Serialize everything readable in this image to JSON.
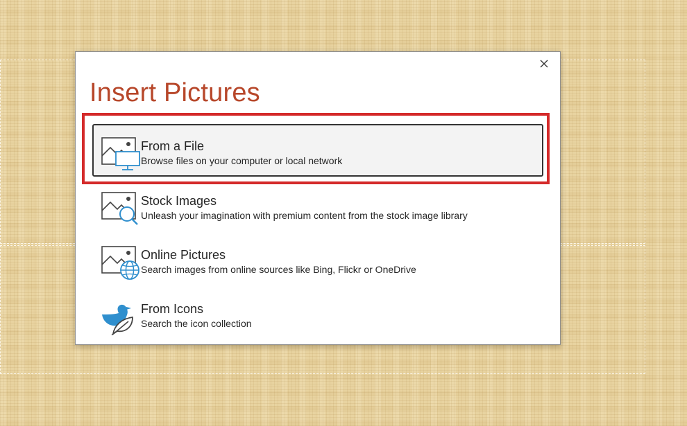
{
  "dialog": {
    "title": "Insert Pictures",
    "close_icon": "close-icon",
    "options": [
      {
        "label": "From a File",
        "description": "Browse files on your computer or local network",
        "icon": "picture-monitor-icon",
        "selected": true
      },
      {
        "label": "Stock Images",
        "description": "Unleash your imagination with premium content from the stock image library",
        "icon": "picture-search-icon",
        "selected": false
      },
      {
        "label": "Online Pictures",
        "description": "Search images from online sources like Bing, Flickr or OneDrive",
        "icon": "picture-globe-icon",
        "selected": false
      },
      {
        "label": "From Icons",
        "description": "Search the icon collection",
        "icon": "duck-leaf-icon",
        "selected": false
      }
    ]
  },
  "colors": {
    "title": "#b7472a",
    "highlight_frame": "#d42a2a",
    "accent_blue": "#2f8fce",
    "slide_background": "#e8d3a0"
  }
}
